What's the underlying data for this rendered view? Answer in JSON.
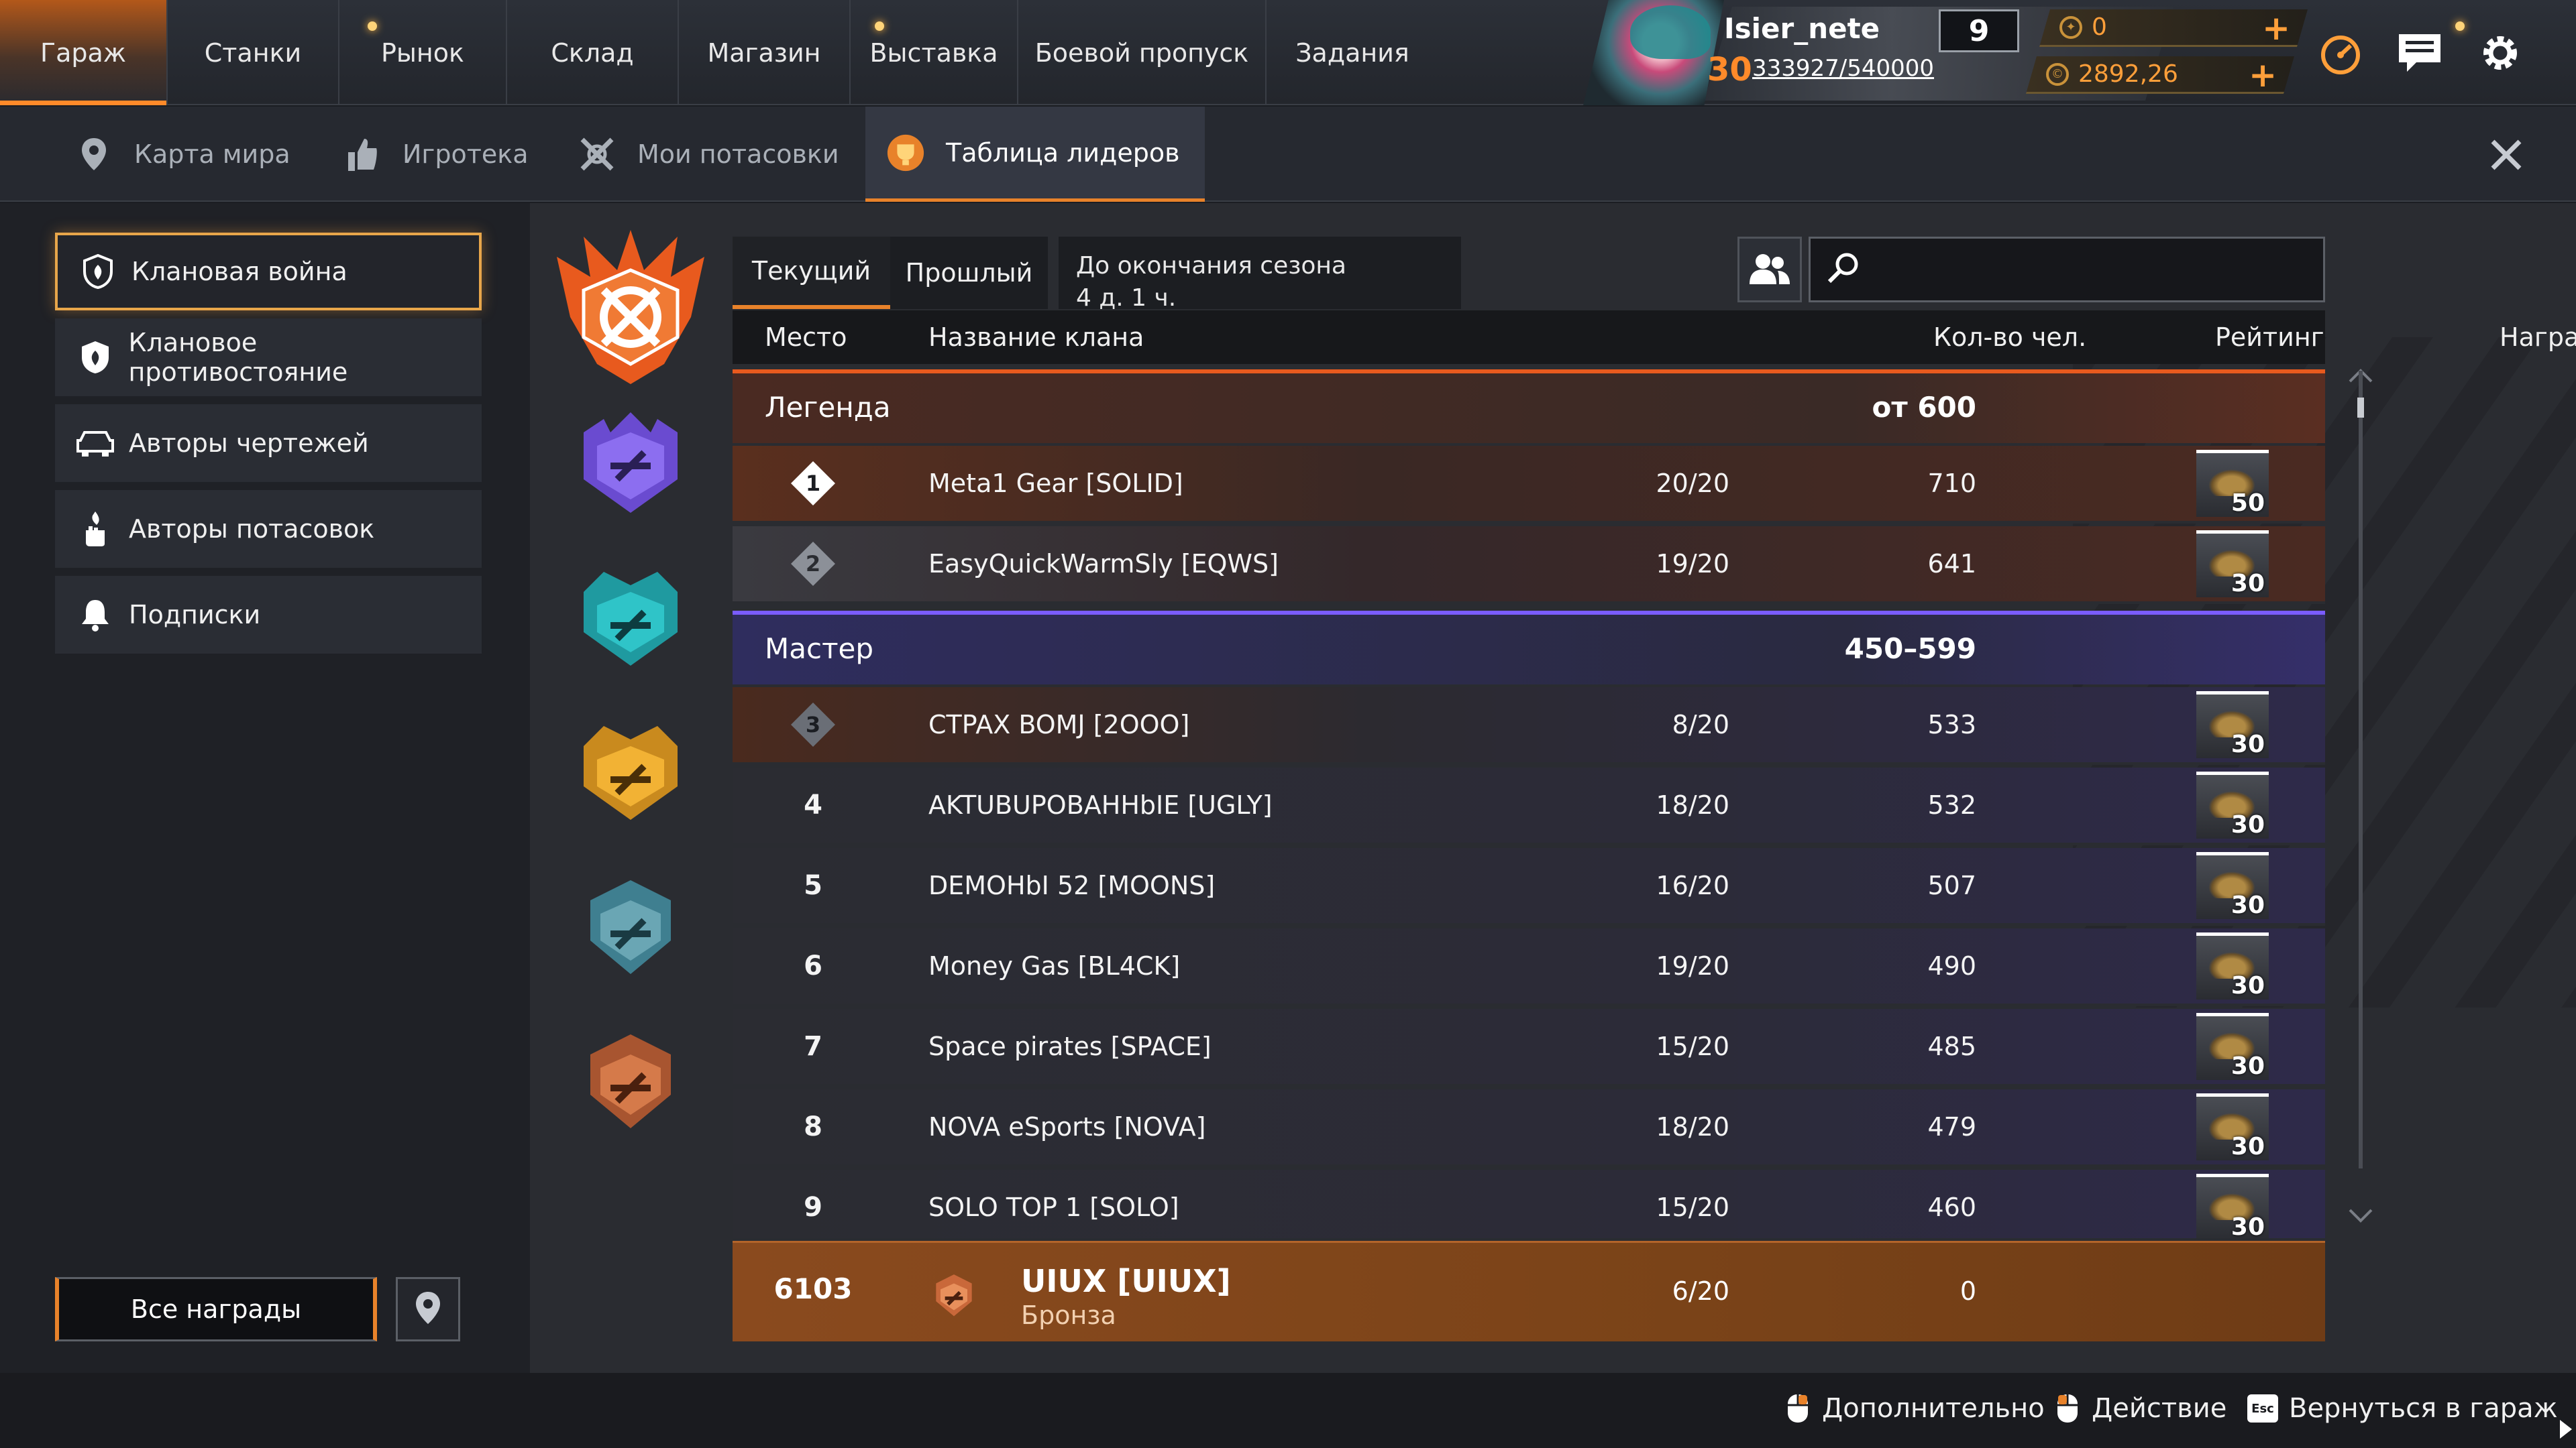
{
  "colors": {
    "accent": "#e8822a",
    "legend_band": "#5a2e22",
    "master_band": "#352f6a",
    "my_row": "#8a4a1e",
    "gold": "#ff9f3a"
  },
  "top_nav": {
    "tabs": [
      "Гараж",
      "Станки",
      "Рынок",
      "Склад",
      "Магазин",
      "Выставка",
      "Боевой пропуск",
      "Задания"
    ],
    "active": "Гараж"
  },
  "player": {
    "name": "Isier_nete",
    "level": "30",
    "xp": "333927/540000",
    "power": "9",
    "currency_badges": "0",
    "currency_coins": "2892,26"
  },
  "sub_nav": {
    "tabs": [
      "Карта мира",
      "Игротека",
      "Мои потасовки",
      "Таблица лидеров"
    ],
    "active": "Таблица лидеров"
  },
  "left_menu": {
    "items": [
      "Клановая война",
      "Клановое противостояние",
      "Авторы чертежей",
      "Авторы потасовок",
      "Подписки"
    ],
    "active": "Клановая война",
    "all_rewards": "Все награды"
  },
  "leaderboard": {
    "tabs": [
      "Текущий",
      "Прошлый"
    ],
    "active_tab": "Текущий",
    "season_label": "До окончания сезона",
    "season_remaining": "4 д. 1 ч.",
    "search_placeholder": "",
    "columns": {
      "place": "Место",
      "clan": "Название клана",
      "members": "Кол-во чел.",
      "rating": "Рейтинг",
      "reward": "Награда"
    },
    "tiers": [
      {
        "name": "Легенда",
        "range": "от 600"
      },
      {
        "name": "Мастер",
        "range": "450–599"
      }
    ],
    "rows": [
      {
        "place": "1",
        "clan": "Meta1 Gear [SOLID]",
        "members": "20/20",
        "rating": "710",
        "reward": "50"
      },
      {
        "place": "2",
        "clan": "EasyQuickWarmSly [EQWS]",
        "members": "19/20",
        "rating": "641",
        "reward": "30"
      },
      {
        "place": "3",
        "clan": "CTPAX BOMJ [2OOO]",
        "members": "8/20",
        "rating": "533",
        "reward": "30"
      },
      {
        "place": "4",
        "clan": "AKTUBUPOBAHHbIE [UGLY]",
        "members": "18/20",
        "rating": "532",
        "reward": "30"
      },
      {
        "place": "5",
        "clan": "DEMOHbI 52 [MOONS]",
        "members": "16/20",
        "rating": "507",
        "reward": "30"
      },
      {
        "place": "6",
        "clan": "Money Gas [BL4CK]",
        "members": "19/20",
        "rating": "490",
        "reward": "30"
      },
      {
        "place": "7",
        "clan": "Space pirates [SPACE]",
        "members": "15/20",
        "rating": "485",
        "reward": "30"
      },
      {
        "place": "8",
        "clan": "NOVA eSports [NOVA]",
        "members": "18/20",
        "rating": "479",
        "reward": "30"
      },
      {
        "place": "9",
        "clan": "SOLO TOP 1 [SOLO]",
        "members": "15/20",
        "rating": "460",
        "reward": "30"
      }
    ],
    "my_clan": {
      "place": "6103",
      "clan": "UIUX [UIUX]",
      "league": "Бронза",
      "members": "6/20",
      "rating": "0"
    }
  },
  "footer": {
    "hints": [
      "Дополнительно",
      "Действие",
      "Вернуться в гараж"
    ],
    "esc_key": "Esc"
  },
  "icons": [
    "pin-icon",
    "thumbs-up-icon",
    "crossed-swords-icon",
    "trophy-icon",
    "close-icon",
    "shield-flame-icon",
    "car-icon",
    "hand-fire-icon",
    "bell-icon",
    "friends-icon",
    "search-icon",
    "speedometer-icon",
    "news-icon",
    "gear-icon",
    "mouse-icon"
  ]
}
